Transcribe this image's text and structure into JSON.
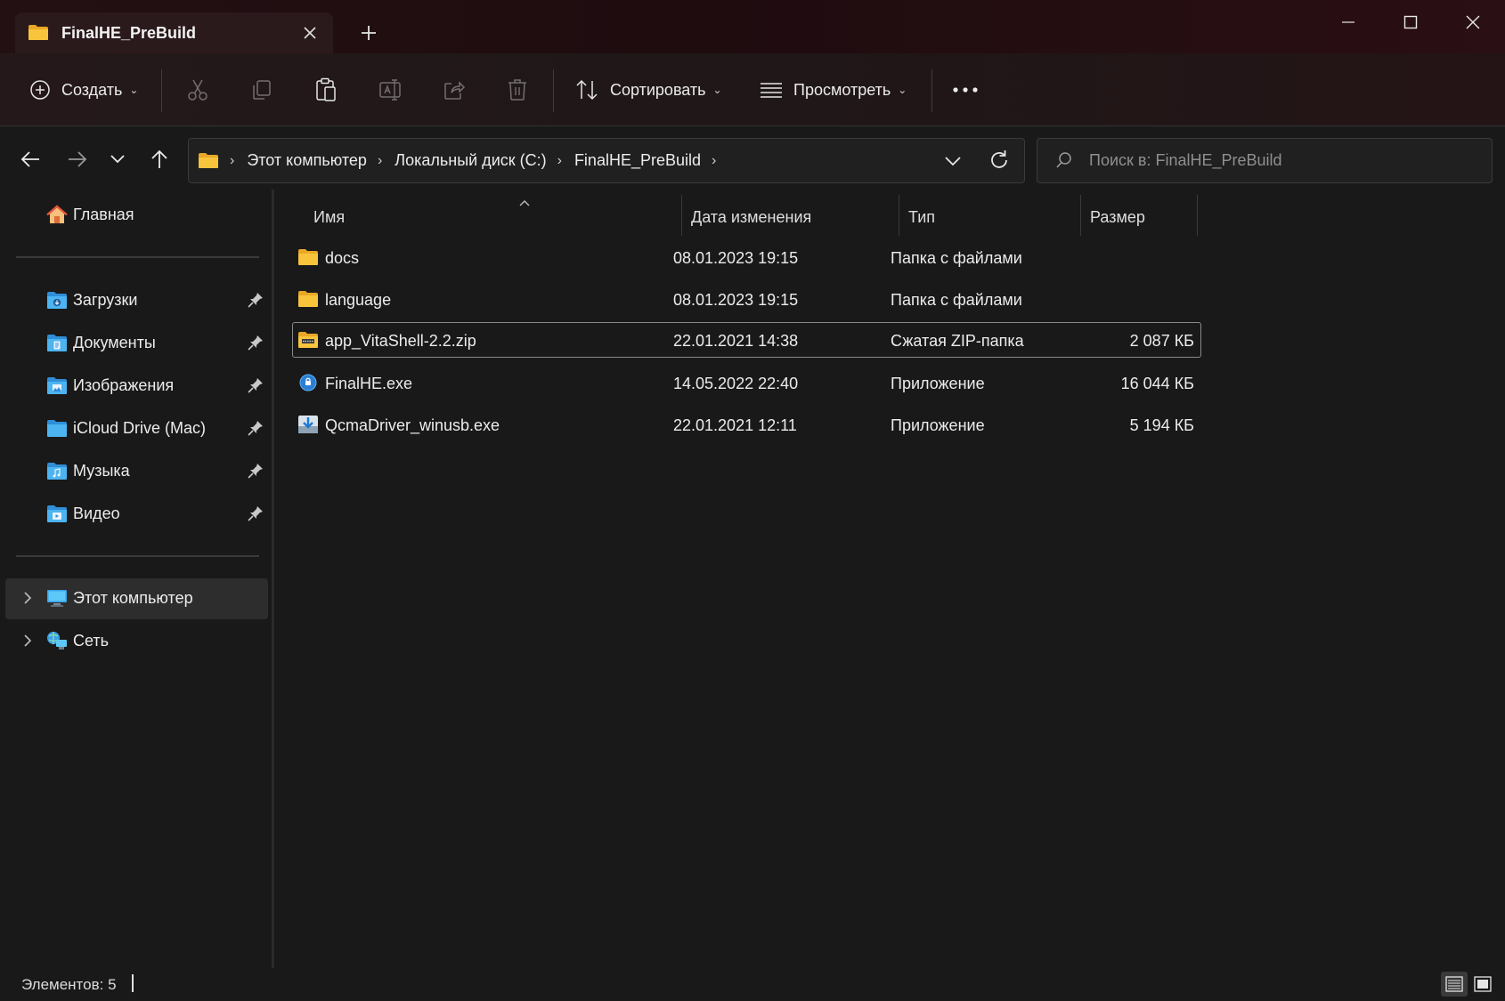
{
  "window": {
    "tab_title": "FinalHE_PreBuild",
    "new_tab_label": "+"
  },
  "toolbar": {
    "create_label": "Создать",
    "sort_label": "Сортировать",
    "view_label": "Просмотреть",
    "more_label": "•••"
  },
  "address": {
    "crumbs": [
      "Этот компьютер",
      "Локальный диск (C:)",
      "FinalHE_PreBuild"
    ],
    "separator": "›"
  },
  "search": {
    "placeholder": "Поиск в: FinalHE_PreBuild",
    "value": ""
  },
  "sidebar": {
    "home_label": "Главная",
    "quick_access": [
      {
        "label": "Загрузки",
        "icon": "downloads-folder-icon"
      },
      {
        "label": "Документы",
        "icon": "documents-folder-icon"
      },
      {
        "label": "Изображения",
        "icon": "pictures-folder-icon"
      },
      {
        "label": "iCloud Drive (Mac)",
        "icon": "icloud-folder-icon"
      },
      {
        "label": "Музыка",
        "icon": "music-folder-icon"
      },
      {
        "label": "Видео",
        "icon": "videos-folder-icon"
      }
    ],
    "this_pc_label": "Этот компьютер",
    "network_label": "Сеть"
  },
  "columns": {
    "name": "Имя",
    "date": "Дата изменения",
    "type": "Тип",
    "size": "Размер"
  },
  "files": [
    {
      "name": "docs",
      "date": "08.01.2023 19:15",
      "type": "Папка с файлами",
      "size": "",
      "icon": "folder-icon"
    },
    {
      "name": "language",
      "date": "08.01.2023 19:15",
      "type": "Папка с файлами",
      "size": "",
      "icon": "folder-icon"
    },
    {
      "name": "app_VitaShell-2.2.zip",
      "date": "22.01.2021 14:38",
      "type": "Сжатая ZIP-папка",
      "size": "2 087 КБ",
      "icon": "zip-folder-icon"
    },
    {
      "name": "FinalHE.exe",
      "date": "14.05.2022 22:40",
      "type": "Приложение",
      "size": "16 044 КБ",
      "icon": "finalhe-app-icon"
    },
    {
      "name": "QcmaDriver_winusb.exe",
      "date": "22.01.2021 12:11",
      "type": "Приложение",
      "size": "5 194 КБ",
      "icon": "installer-app-icon"
    }
  ],
  "status": {
    "items_text": "Элементов: 5"
  },
  "colors": {
    "accent": "#4cc2ff",
    "folder": "#f8c43c",
    "background": "#191919"
  }
}
